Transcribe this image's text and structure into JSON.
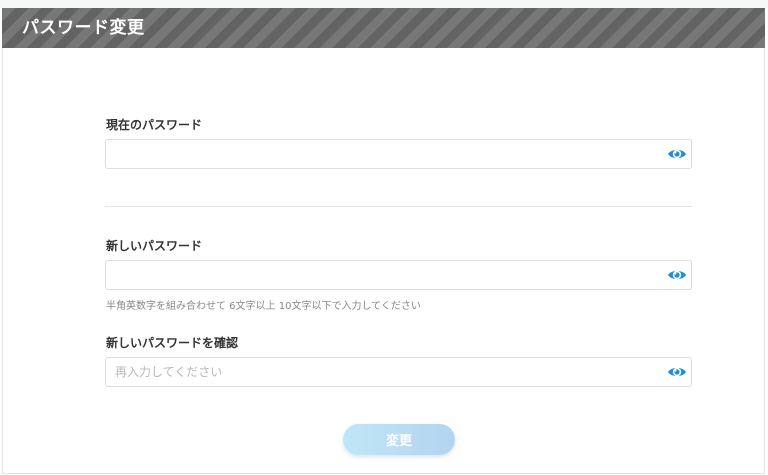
{
  "header": {
    "title": "パスワード変更"
  },
  "current_password": {
    "label": "現在のパスワード",
    "value": "",
    "placeholder": ""
  },
  "new_password": {
    "label": "新しいパスワード",
    "value": "",
    "placeholder": "",
    "hint": "半角英数字を組み合わせて 6文字以上 10文字以下で入力してください"
  },
  "confirm_password": {
    "label": "新しいパスワードを確認",
    "value": "",
    "placeholder": "再入力してください"
  },
  "submit": {
    "label": "変更",
    "enabled": false
  },
  "icons": {
    "toggle_visibility": "eye-icon"
  },
  "colors": {
    "header_bg": "#6f6f6f",
    "icon_accent": "#1b8fd8",
    "button_gradient_start": "#bfe6f6",
    "button_gradient_end": "#b3d4f0"
  }
}
